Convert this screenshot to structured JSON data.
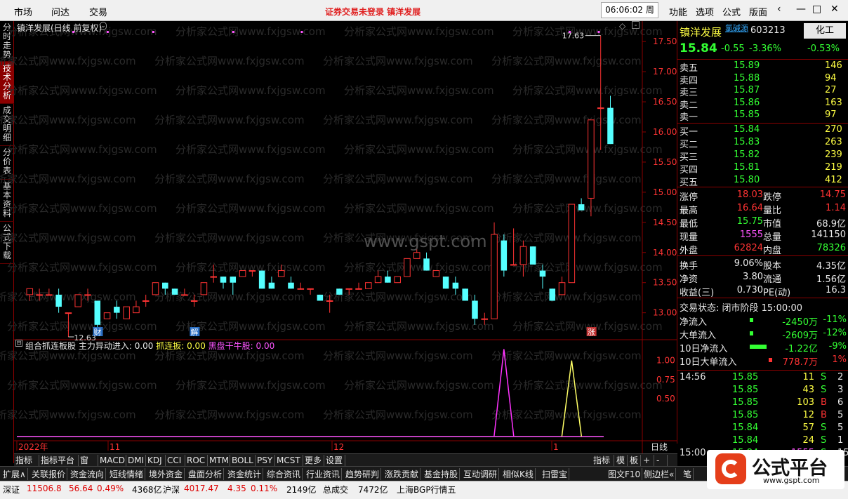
{
  "topbar": {
    "menus": [
      "市场",
      "问达",
      "交易"
    ],
    "alert": "证券交易未登录   镇洋发展",
    "clock": "06:06:02 周三",
    "right_menus": [
      "功能",
      "选项",
      "公式",
      "版面"
    ]
  },
  "left_tabs": [
    "分时走势",
    "技术分析",
    "成交明细",
    "分价表",
    "基本资料",
    "公式下载"
  ],
  "chart_header": {
    "name": "镇洋发展(日线 前复权)"
  },
  "indicator_header": {
    "name": "组合抓连板股",
    "label1": "主力异动进入: 0.00",
    "label2": "抓连扳: 0.00",
    "label3": "黑盘干牛股: 0.00"
  },
  "watermark": "www.gspt.com",
  "watermark_rows": "分析家公式网www.fxjgsw.com",
  "chart_data": {
    "type": "candlestick",
    "ylim": [
      12.6,
      17.7
    ],
    "yticks": [
      "17.50",
      "17.00",
      "16.50",
      "16.00",
      "15.50",
      "15.00",
      "14.50",
      "14.00",
      "13.50",
      "13.00"
    ],
    "max_label": "17.63",
    "min_label": "12.63",
    "xlabels": [
      "2022年",
      "11",
      "12",
      "1",
      "日线"
    ],
    "markers": [
      "财",
      "解",
      "涨"
    ],
    "candles": [
      [
        13.3,
        13.4,
        13.2,
        13.4
      ],
      [
        13.3,
        13.4,
        13.2,
        13.3
      ],
      [
        13.3,
        13.4,
        13.3,
        13.3
      ],
      [
        13.3,
        13.4,
        13.0,
        13.1
      ],
      [
        13.0,
        13.0,
        12.6,
        13.0
      ],
      [
        13.1,
        13.3,
        13.1,
        13.3
      ],
      [
        13.3,
        13.4,
        13.2,
        13.3
      ],
      [
        13.2,
        13.2,
        12.7,
        12.8
      ],
      [
        12.9,
        13.0,
        12.9,
        13.0
      ],
      [
        13.1,
        13.2,
        12.9,
        13.0
      ],
      [
        12.9,
        13.1,
        12.9,
        13.1
      ],
      [
        13.0,
        13.2,
        13.0,
        13.1
      ],
      [
        13.2,
        13.3,
        13.1,
        13.2
      ],
      [
        13.3,
        13.5,
        13.3,
        13.5
      ],
      [
        13.5,
        13.5,
        13.3,
        13.4
      ],
      [
        13.4,
        13.4,
        13.3,
        13.3
      ],
      [
        13.3,
        13.4,
        13.3,
        13.3
      ],
      [
        13.2,
        13.3,
        13.1,
        13.2
      ],
      [
        13.3,
        13.5,
        13.3,
        13.5
      ],
      [
        13.6,
        13.8,
        13.5,
        13.6
      ],
      [
        13.6,
        13.6,
        13.4,
        13.5
      ],
      [
        13.6,
        13.6,
        13.3,
        13.5
      ],
      [
        13.6,
        13.7,
        13.6,
        13.7
      ],
      [
        13.7,
        13.7,
        13.6,
        13.7
      ],
      [
        13.7,
        13.7,
        13.4,
        13.4
      ],
      [
        13.5,
        13.6,
        13.4,
        13.4
      ],
      [
        13.6,
        13.8,
        13.6,
        13.7
      ],
      [
        13.5,
        13.6,
        13.4,
        13.4
      ],
      [
        13.4,
        13.5,
        13.4,
        13.4
      ],
      [
        13.4,
        13.4,
        13.3,
        13.4
      ],
      [
        13.3,
        13.3,
        13.2,
        13.2
      ],
      [
        13.2,
        13.3,
        13.0,
        13.2
      ],
      [
        13.4,
        13.4,
        13.3,
        13.3
      ],
      [
        13.4,
        13.4,
        13.3,
        13.4
      ],
      [
        13.4,
        13.5,
        13.4,
        13.4
      ],
      [
        13.4,
        13.5,
        13.4,
        13.5
      ],
      [
        13.5,
        13.7,
        13.5,
        13.6
      ],
      [
        13.6,
        13.7,
        13.5,
        13.5
      ],
      [
        13.5,
        13.6,
        13.5,
        13.6
      ],
      [
        13.6,
        13.9,
        13.6,
        13.9
      ],
      [
        13.9,
        14.1,
        13.9,
        14.0
      ],
      [
        13.9,
        14.0,
        13.7,
        13.7
      ],
      [
        13.6,
        13.7,
        13.6,
        13.7
      ],
      [
        13.6,
        13.6,
        13.4,
        13.4
      ],
      [
        13.5,
        13.6,
        13.3,
        13.4
      ],
      [
        13.4,
        13.4,
        13.2,
        13.2
      ],
      [
        13.2,
        13.3,
        12.8,
        12.9
      ],
      [
        12.9,
        13.0,
        12.8,
        12.9
      ],
      [
        12.9,
        14.5,
        12.9,
        14.3
      ],
      [
        14.2,
        14.3,
        13.6,
        13.7
      ],
      [
        13.8,
        14.4,
        13.8,
        13.8
      ],
      [
        13.8,
        14.2,
        13.6,
        14.1
      ],
      [
        14.1,
        14.1,
        13.8,
        13.8
      ],
      [
        13.7,
        13.8,
        13.4,
        13.6
      ],
      [
        13.4,
        13.4,
        13.2,
        13.2
      ],
      [
        13.3,
        13.6,
        13.3,
        13.5
      ],
      [
        13.5,
        14.7,
        13.5,
        14.8
      ],
      [
        14.8,
        14.9,
        14.7,
        14.7
      ],
      [
        14.9,
        16.2,
        14.6,
        16.2
      ],
      [
        16.4,
        17.6,
        15.7,
        16.4
      ],
      [
        16.4,
        16.6,
        15.8,
        15.8
      ]
    ],
    "indicator": {
      "ylim": [
        0,
        1.2
      ],
      "yticks": [
        "1.00",
        "0.75",
        "0.50"
      ],
      "spikes": [
        {
          "center": 49,
          "height": 1.15,
          "color": "#ff33ff"
        },
        {
          "center": 56,
          "height": 1.0,
          "color": "#ffff66"
        }
      ]
    }
  },
  "quote": {
    "name": "镇洋发展",
    "badge": "氯碱源",
    "code": "603213",
    "sector": "化工",
    "price": "15.84",
    "change": "-0.55",
    "pct": "-3.36%",
    "sector_pct": "-0.53%",
    "asks": [
      [
        "卖五",
        "15.89",
        "146"
      ],
      [
        "卖四",
        "15.88",
        "94"
      ],
      [
        "卖三",
        "15.87",
        "27"
      ],
      [
        "卖二",
        "15.86",
        "163"
      ],
      [
        "卖一",
        "15.85",
        "97"
      ]
    ],
    "bids": [
      [
        "买一",
        "15.84",
        "270"
      ],
      [
        "买二",
        "15.83",
        "263"
      ],
      [
        "买三",
        "15.82",
        "239"
      ],
      [
        "买四",
        "15.81",
        "219"
      ],
      [
        "买五",
        "15.80",
        "412"
      ]
    ],
    "stats": [
      [
        "涨停",
        "18.03",
        "跌停",
        "14.75"
      ],
      [
        "最高",
        "16.64",
        "量比",
        "1.14"
      ],
      [
        "最低",
        "15.75",
        "市值",
        "68.9亿"
      ],
      [
        "现量",
        "1555",
        "总量",
        "141150"
      ],
      [
        "外盘",
        "62824",
        "内盘",
        "78326"
      ]
    ],
    "stats2": [
      [
        "换手",
        "9.06%",
        "股本",
        "4.35亿"
      ],
      [
        "净资",
        "3.80",
        "流通",
        "1.56亿"
      ],
      [
        "收益(三)",
        "0.730",
        "PE(动)",
        "16.3"
      ]
    ],
    "status": "交易状态: 闭市阶段 15:00:00",
    "flows": [
      [
        "净流入",
        "-2450万",
        "-11%"
      ],
      [
        "大单流入",
        "-2609万",
        "-12%"
      ],
      [
        "10日净流入",
        "-1.22亿",
        "-9%"
      ],
      [
        "10日大单流入",
        "778.7万",
        "1%"
      ]
    ],
    "ticks": [
      [
        "14:56",
        "15.85",
        "11",
        "S",
        "2"
      ],
      [
        "",
        "15.85",
        "43",
        "S",
        "3"
      ],
      [
        "",
        "15.85",
        "103",
        "B",
        "6"
      ],
      [
        "",
        "15.85",
        "12",
        "B",
        "5"
      ],
      [
        "",
        "15.84",
        "57",
        "S",
        "5"
      ],
      [
        "",
        "15.84",
        "24",
        "S",
        "1"
      ],
      [
        "15:00",
        "15.84",
        "1555",
        "S",
        "156"
      ]
    ]
  },
  "tabs": [
    "指标A",
    "指标平台",
    "窗口",
    "MACD",
    "DMI",
    "KDJ",
    "CCI",
    "ROC",
    "MTM",
    "BOLL",
    "PSY",
    "MCST",
    "更多",
    "设置"
  ],
  "tabs_right": [
    "指标B",
    "模",
    "板",
    "+",
    "-"
  ],
  "funcbar": [
    "扩展∧",
    "关联报价",
    "资金流向",
    "短线情绪",
    "境外资金",
    "盘面分析",
    "资金统计",
    "综合资讯",
    "行业资讯",
    "趋势研判",
    "涨跌贡献",
    "基金持股",
    "互动调研",
    "相似K线",
    "扫雷宝",
    "图文F10",
    "侧边栏«",
    "笔"
  ],
  "status": {
    "sz_label": "深证",
    "sz": "11506.8",
    "sz_chg": "56.64",
    "sz_pct": "0.49%",
    "sz_amt": "4368亿",
    "hs_label": "沪深",
    "hs": "4017.47",
    "hs_chg": "4.35",
    "hs_pct": "0.11%",
    "hs_amt": "2149亿",
    "total_label": "总成交",
    "total": "7472亿",
    "feed": "上海BGP行情五"
  },
  "logo": {
    "text": "公式平台",
    "url": "www.gspt.com"
  }
}
